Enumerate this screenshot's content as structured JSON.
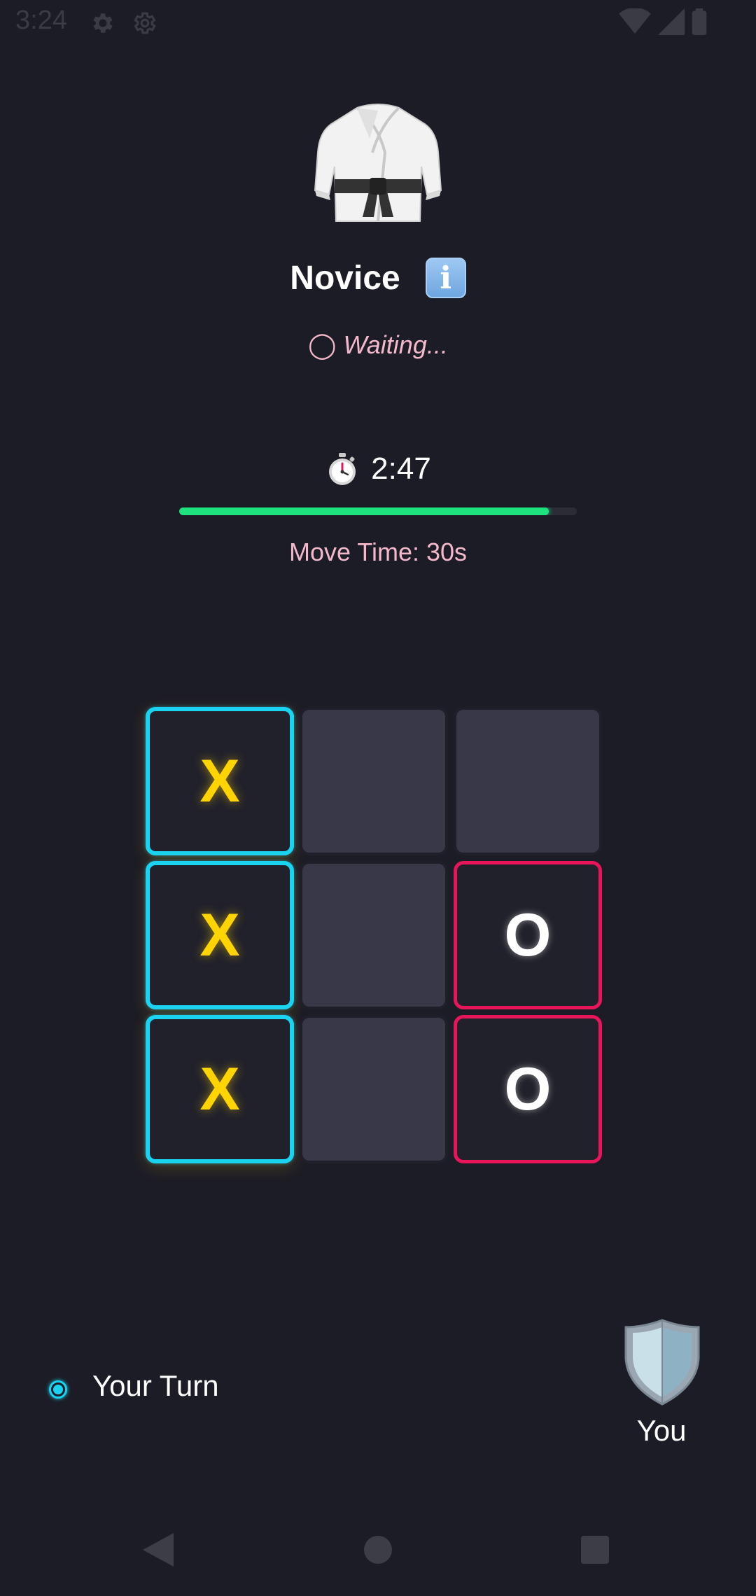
{
  "status_bar": {
    "time": "3:24",
    "icons": [
      "gear-icon",
      "gear-icon",
      "wifi-icon",
      "cell-signal-icon",
      "battery-icon"
    ]
  },
  "opponent": {
    "avatar_icon": "karate-uniform-icon",
    "name": "Novice",
    "info_icon": "information-icon",
    "info_label": "i",
    "status": "◯ Waiting..."
  },
  "timer": {
    "icon": "stopwatch-icon",
    "value": "2:47",
    "progress": 0.93,
    "progress_color": "#1ee27d",
    "move_time_label": "Move Time: 30s"
  },
  "board": {
    "cells": [
      "X",
      "",
      "",
      "X",
      "",
      "O",
      "X",
      "",
      "O"
    ],
    "x_color": "#ffd400",
    "x_border": "#1ad3f1",
    "o_color": "#ffffff",
    "o_border": "#e8155a",
    "empty_color": "#393848"
  },
  "footer": {
    "turn_icon": "radio-dot-icon",
    "turn_label": "Your Turn",
    "player_icon": "shield-icon",
    "player_label": "You"
  },
  "nav": {
    "icons": [
      "back-icon",
      "home-icon",
      "recents-icon"
    ]
  },
  "colors": {
    "background": "#1c1c26",
    "accent_pink": "#f4b8cb",
    "accent_cyan": "#1ad3f1"
  }
}
